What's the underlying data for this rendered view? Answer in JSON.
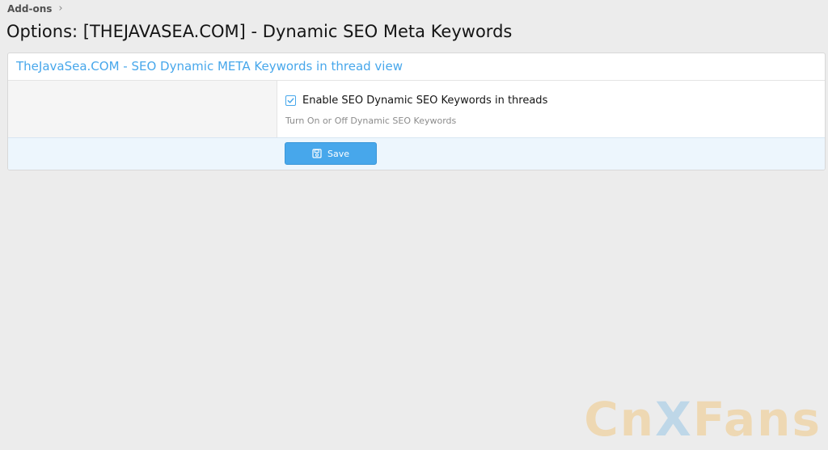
{
  "breadcrumb": {
    "item": "Add-ons"
  },
  "page": {
    "title": "Options: [THEJAVASEA.COM] - Dynamic SEO Meta Keywords"
  },
  "panel": {
    "header": "TheJavaSea.COM - SEO Dynamic META Keywords in thread view",
    "option": {
      "label": "Enable SEO Dynamic SEO Keywords in threads",
      "hint": "Turn On or Off Dynamic SEO Keywords",
      "checked": true
    }
  },
  "actions": {
    "save_label": "Save"
  },
  "watermark": {
    "part1": "Cn",
    "part2": "X",
    "part3": "Fans"
  },
  "colors": {
    "accent": "#47a7eb",
    "background": "#ececec",
    "submit_row": "#edf6fd"
  },
  "icons": {
    "breadcrumb": "chevron-right-icon",
    "checkbox": "check-icon",
    "save": "floppy-disk-icon"
  }
}
